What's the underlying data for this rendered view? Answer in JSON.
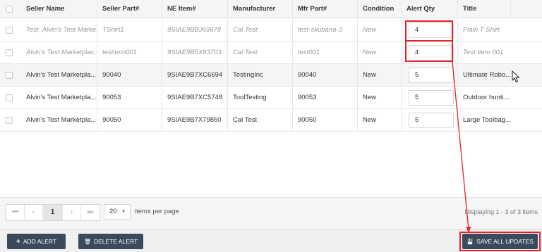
{
  "columns": [
    "Seller Name",
    "Seller Part#",
    "NE Item#",
    "Manufacturer",
    "Mfr Part#",
    "Condition",
    "Alert Qty",
    "Title"
  ],
  "rows": [
    {
      "seller_name": "Test_Alvin's Test Marke...",
      "seller_part": "TShirt1",
      "ne_item": "9SIAE9BBJ69678",
      "manufacturer": "Cal Test",
      "mfr_part": "test-skubana-3",
      "condition": "New",
      "alert_qty": "4",
      "title": "Plain T Shirt"
    },
    {
      "seller_name": "Alvin's Test Marketplac...",
      "seller_part": "testitem001",
      "ne_item": "9SIAE9B5X93703",
      "manufacturer": "Cal Test",
      "mfr_part": "test001",
      "condition": "New",
      "alert_qty": "4",
      "title": "Test Item 001"
    },
    {
      "seller_name": "Alvin's Test Marketpla...",
      "seller_part": "90040",
      "ne_item": "9SIAE9B7XC6694",
      "manufacturer": "TestingInc",
      "mfr_part": "90040",
      "condition": "New",
      "alert_qty": "5",
      "title": "Ultimate Robo..."
    },
    {
      "seller_name": "Alvin's Test Marketpla...",
      "seller_part": "90053",
      "ne_item": "9SIAE9B7XC5748",
      "manufacturer": "ToolTesting",
      "mfr_part": "90053",
      "condition": "New",
      "alert_qty": "5",
      "title": "Outdoor hunti..."
    },
    {
      "seller_name": "Alvin's Test Marketpla...",
      "seller_part": "90050",
      "ne_item": "9SIAE9B7X79850",
      "manufacturer": "Cal Test",
      "mfr_part": "90050",
      "condition": "New",
      "alert_qty": "5",
      "title": "Large Toolbag..."
    }
  ],
  "pager": {
    "first": "⏮",
    "prev": "‹",
    "page": "1",
    "next": "›",
    "last": "⏭",
    "page_size": "20",
    "items_per_page": "items per page",
    "display": "Displaying 1 - 3 of 3 items"
  },
  "footer": {
    "add_icon": "+",
    "add_label": "ADD ALERT",
    "delete_icon": "🗑",
    "delete_label": "DELETE ALERT",
    "save_icon": "💾",
    "save_label": "SAVE ALL UPDATES"
  },
  "colors": {
    "highlight": "#e0242a",
    "button_bg": "#3a4a5c",
    "header_bg": "#f5f5f5"
  }
}
